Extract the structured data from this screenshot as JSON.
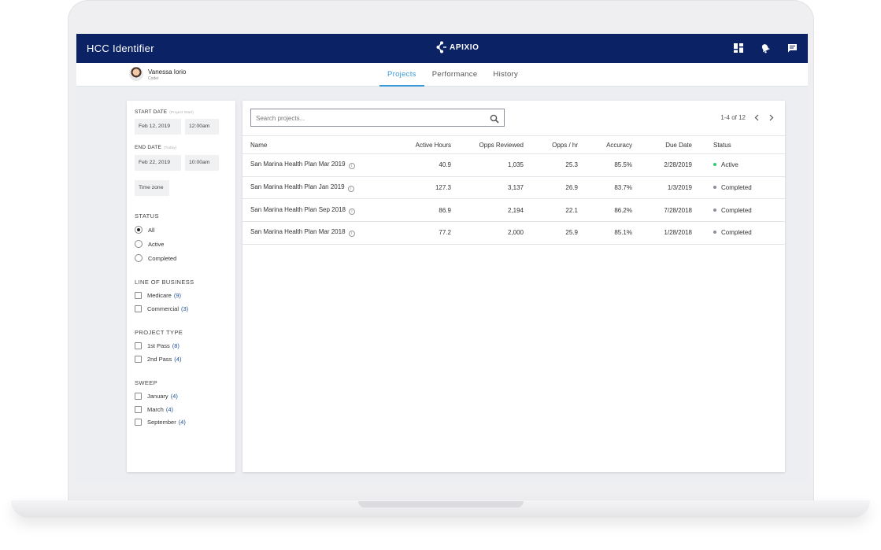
{
  "app": {
    "title": "HCC Identifier",
    "logo_text": "APIXIO"
  },
  "header_icons": [
    "dashboard-icon",
    "notifications-icon",
    "messages-icon"
  ],
  "user": {
    "name": "Vanessa Iorio",
    "role": "Coder"
  },
  "tabs": [
    {
      "label": "Projects",
      "active": true
    },
    {
      "label": "Performance",
      "active": false
    },
    {
      "label": "History",
      "active": false
    }
  ],
  "filters": {
    "start_date": {
      "label": "START DATE",
      "hint": "(Project Start)",
      "date": "Feb 12, 2019",
      "time": "12:00am"
    },
    "end_date": {
      "label": "END DATE",
      "hint": "(Today)",
      "date": "Feb 22, 2019",
      "time": "10:00am"
    },
    "timezone_label": "Time zone",
    "status": {
      "title": "STATUS",
      "options": [
        {
          "label": "All",
          "selected": true
        },
        {
          "label": "Active",
          "selected": false
        },
        {
          "label": "Completed",
          "selected": false
        }
      ]
    },
    "line_of_business": {
      "title": "LINE OF BUSINESS",
      "options": [
        {
          "label": "Medicare",
          "count": "(9)"
        },
        {
          "label": "Commercial",
          "count": "(3)"
        }
      ]
    },
    "project_type": {
      "title": "PROJECT TYPE",
      "options": [
        {
          "label": "1st Pass",
          "count": "(8)"
        },
        {
          "label": "2nd Pass",
          "count": "(4)"
        }
      ]
    },
    "sweep": {
      "title": "SWEEP",
      "options": [
        {
          "label": "January",
          "count": "(4)"
        },
        {
          "label": "March",
          "count": "(4)"
        },
        {
          "label": "September",
          "count": "(4)"
        }
      ]
    }
  },
  "search": {
    "placeholder": "Search projects...",
    "value": ""
  },
  "pagination": {
    "text": "1-4 of 12"
  },
  "table": {
    "columns": [
      "Name",
      "Active Hours",
      "Opps Reviewed",
      "Opps / hr",
      "Accuracy",
      "Due Date",
      "Status"
    ],
    "rows": [
      {
        "name": "San Marina Health Plan Mar 2019",
        "hours": "40.9",
        "opps": "1,035",
        "per_hr": "25.3",
        "accuracy": "85.5%",
        "due": "2/28/2019",
        "status": "Active"
      },
      {
        "name": "San Marina Health Plan Jan 2019",
        "hours": "127.3",
        "opps": "3,137",
        "per_hr": "26.9",
        "accuracy": "83.7%",
        "due": "1/3/2019",
        "status": "Completed"
      },
      {
        "name": "San Marina Health Plan Sep 2018",
        "hours": "86.9",
        "opps": "2,194",
        "per_hr": "22.1",
        "accuracy": "86.2%",
        "due": "7/28/2018",
        "status": "Completed"
      },
      {
        "name": "San Marina Health Plan Mar 2018",
        "hours": "77.2",
        "opps": "2,000",
        "per_hr": "25.9",
        "accuracy": "85.1%",
        "due": "1/28/2018",
        "status": "Completed"
      }
    ]
  },
  "colors": {
    "header": "#0b2264",
    "accent": "#3a9ad9",
    "active_status": "#2ecc71",
    "completed_status": "#8a8f99",
    "count": "#1f4f95"
  }
}
